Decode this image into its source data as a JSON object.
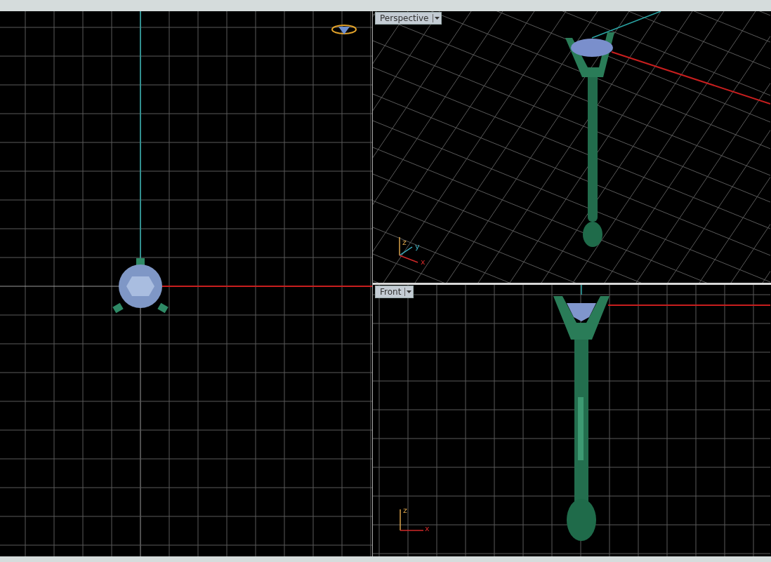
{
  "viewports": [
    {
      "kind": "top"
    },
    {
      "kind": "perspective",
      "label": "Perspective",
      "axes": [
        "z",
        "y",
        "x"
      ]
    },
    {
      "kind": "front",
      "label": "Front",
      "axes": [
        "z",
        "x"
      ]
    }
  ]
}
